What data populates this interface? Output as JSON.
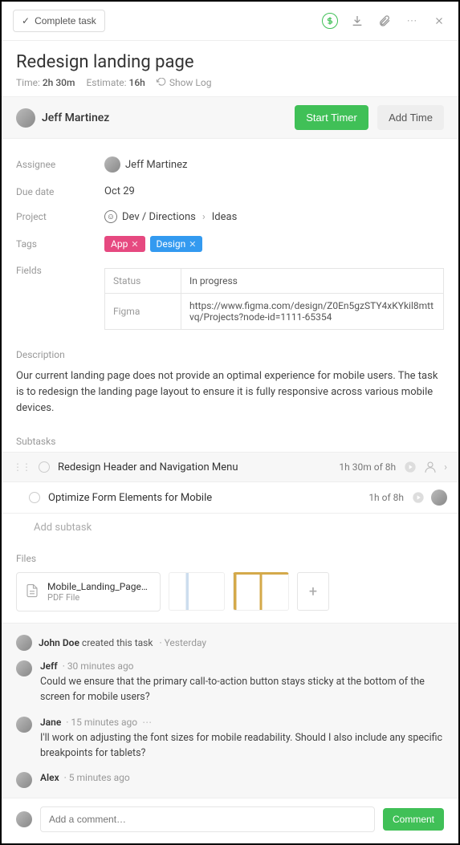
{
  "topbar": {
    "complete_label": "Complete task"
  },
  "header": {
    "title": "Redesign landing page",
    "time_label": "Time:",
    "time_value": "2h 30m",
    "estimate_label": "Estimate:",
    "estimate_value": "16h",
    "showlog": "Show Log"
  },
  "userbar": {
    "name": "Jeff Martinez",
    "start_timer": "Start Timer",
    "add_time": "Add Time"
  },
  "details": {
    "assignee_label": "Assignee",
    "assignee_value": "Jeff Martinez",
    "due_label": "Due date",
    "due_value": "Oct 29",
    "project_label": "Project",
    "project_path1": "Dev / Directions",
    "project_path2": "Ideas",
    "tags_label": "Tags",
    "tags": [
      {
        "text": "App",
        "color": "#e64980"
      },
      {
        "text": "Design",
        "color": "#339af0"
      }
    ],
    "fields_label": "Fields",
    "fields": [
      {
        "name": "Status",
        "value": "In progress"
      },
      {
        "name": "Figma",
        "value": "https://www.figma.com/design/Z0En5gzSTY4xKYkil8mttvq/Projects?node-id=1111-65354"
      }
    ]
  },
  "description": {
    "label": "Description",
    "text": "Our current landing page does not provide an optimal experience for mobile users. The task is to redesign the landing page layout to ensure it is fully responsive across various mobile devices."
  },
  "subtasks": {
    "label": "Subtasks",
    "items": [
      {
        "title": "Redesign Header and Navigation Menu",
        "time": "1h 30m of 8h"
      },
      {
        "title": "Optimize Form Elements for Mobile",
        "time": "1h of 8h"
      }
    ],
    "add": "Add subtask"
  },
  "files": {
    "label": "Files",
    "file_name": "Mobile_Landing_Page_Wir…",
    "file_type": "PDF File"
  },
  "activity": {
    "creator_name": "John Doe",
    "creator_action": "created this task",
    "creator_ago": "Yesterday",
    "comments": [
      {
        "name": "Jeff",
        "ago": "30 minutes ago",
        "body": "Could we ensure that the primary call-to-action button stays sticky at the bottom of the screen for mobile users?"
      },
      {
        "name": "Jane",
        "ago": "15 minutes ago",
        "body": "I'll work on adjusting the font sizes for mobile readability. Should I also include any specific breakpoints for tablets?"
      },
      {
        "name": "Alex",
        "ago": "5 minutes ago",
        "body": ""
      }
    ]
  },
  "comment_box": {
    "placeholder": "Add a comment…",
    "button": "Comment"
  }
}
